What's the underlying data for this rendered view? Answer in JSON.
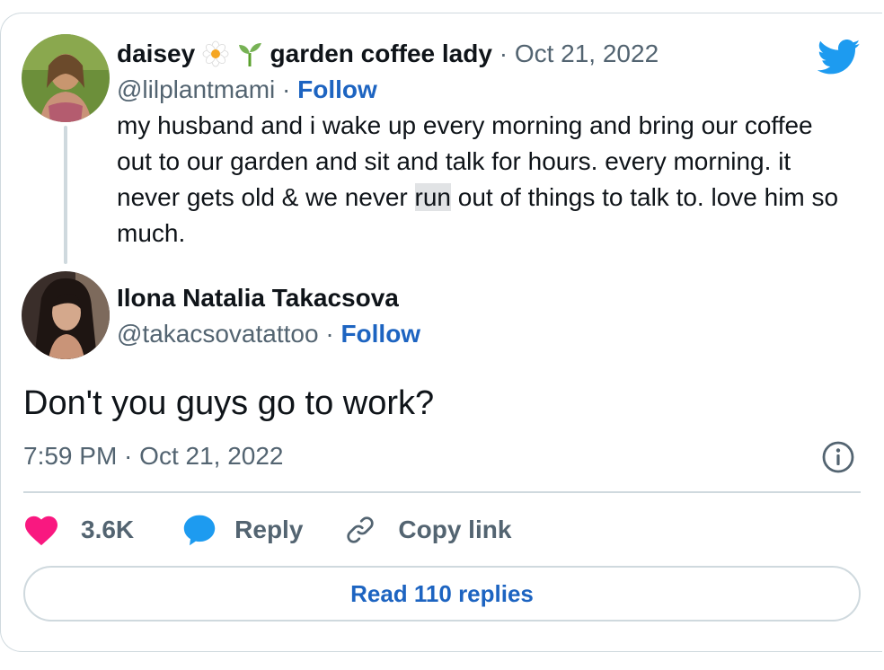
{
  "quoted_tweet": {
    "display_name": "daisey",
    "display_name_suffix": "garden coffee lady",
    "name_emojis": [
      "flower-emoji",
      "seedling-emoji"
    ],
    "date": "Oct 21, 2022",
    "handle": "@lilplantmami",
    "follow_label": "Follow",
    "text_before_highlight": "my husband and i wake up every morning and bring our coffee out to our garden and sit and talk for hours. every morning. it never gets old & we never ",
    "text_highlight": "run",
    "text_after_highlight": " out of things to talk to. love him so much."
  },
  "reply_tweet": {
    "display_name": "Ilona Natalia Takacsova",
    "handle": "@takacsovatattoo",
    "follow_label": "Follow",
    "text": "Don't you guys go to work?",
    "timestamp": "7:59 PM · Oct 21, 2022"
  },
  "actions": {
    "like_count": "3.6K",
    "reply_label": "Reply",
    "copy_link_label": "Copy link"
  },
  "read_replies_label": "Read 110 replies",
  "separator": "·",
  "icons": {
    "brand": "twitter-bird-icon",
    "info": "info-icon",
    "like": "heart-icon",
    "reply": "speech-bubble-icon",
    "copy": "link-icon"
  },
  "colors": {
    "link_blue": "#1d64c1",
    "twitter_blue": "#1d9bf0",
    "like_pink": "#f91880",
    "muted_text": "#536471",
    "border": "#cfd9de"
  }
}
